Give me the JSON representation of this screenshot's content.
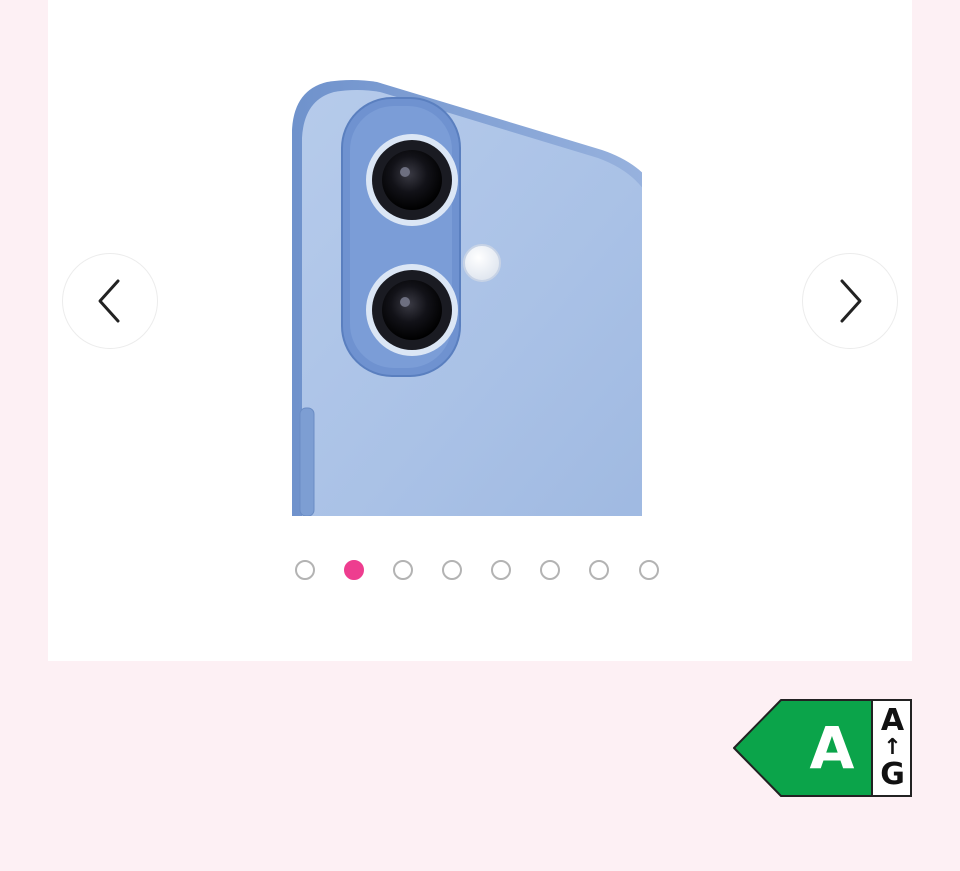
{
  "gallery": {
    "image_icon": "iphone-camera-blue-image",
    "prev_icon": "chevron-left-icon",
    "next_icon": "chevron-right-icon",
    "slide_count": 8,
    "active_slide": 2
  },
  "energy_label": {
    "grade": "A",
    "scale_top": "A",
    "scale_arrow": "↑",
    "scale_bottom": "G",
    "color": "#0ba44a"
  },
  "colors": {
    "accent": "#ee3d8f",
    "page_bg": "#fdf0f4"
  }
}
